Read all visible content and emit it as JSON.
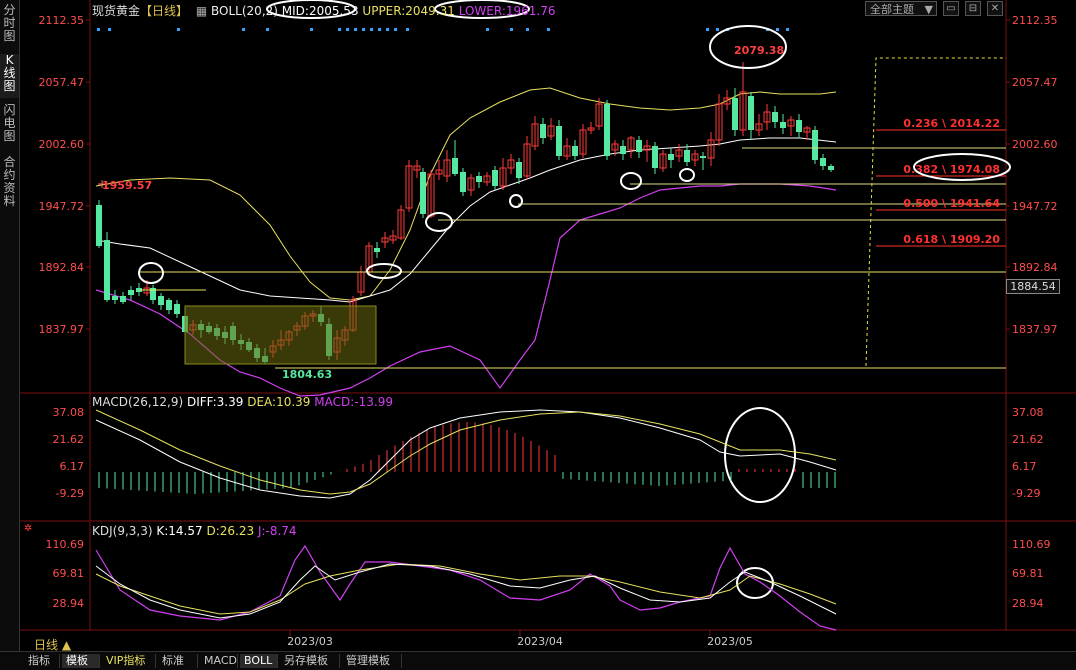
{
  "sidebar": {
    "tabs": [
      {
        "label": "分时图",
        "active": false
      },
      {
        "label": "K线图",
        "active": true
      },
      {
        "label": "闪电图",
        "active": false
      },
      {
        "label": "合约资料",
        "active": false
      }
    ]
  },
  "header": {
    "title": "现货黄金",
    "period": "【日线】",
    "boll_label": "BOLL(20,2)",
    "mid": "MID:2005.53",
    "upper": "UPPER:2049.31",
    "lower": "LOWER:1961.76"
  },
  "toolbar": {
    "theme_select": "全部主题",
    "buttons": [
      "▭",
      "⊟",
      "✕"
    ]
  },
  "price_axis": {
    "labels": [
      "2112.35",
      "2057.47",
      "2002.60",
      "1947.72",
      "1892.84",
      "1837.97"
    ],
    "current_price": "1884.54"
  },
  "annotations": {
    "high_label": "2079.38",
    "low_label": "1804.63",
    "left_label": "1959.57",
    "fib": [
      {
        "label": "0.236 \\ 2014.22"
      },
      {
        "label": "0.382 \\ 1974.08"
      },
      {
        "label": "0.500 \\ 1941.64"
      },
      {
        "label": "0.618 \\ 1909.20"
      }
    ]
  },
  "macd": {
    "label": "MACD(26,12,9)",
    "diff": "DIFF:3.39",
    "dea": "DEA:10.39",
    "macd": "MACD:-13.99",
    "axis": [
      "37.08",
      "21.62",
      "6.17",
      "-9.29"
    ]
  },
  "kdj": {
    "label": "KDJ(9,3,3)",
    "k": "K:14.57",
    "d": "D:26.23",
    "j": "J:-8.74",
    "axis": [
      "110.69",
      "69.81",
      "28.94"
    ]
  },
  "time_axis": [
    "2023/03",
    "2023/04",
    "2023/05"
  ],
  "period_label": "日线 ▲",
  "bottom_tabs": [
    {
      "label": "指标",
      "active": false
    },
    {
      "label": "模板",
      "active": true
    },
    {
      "label": "VIP指标",
      "active": false
    },
    {
      "label": "标准",
      "active": false
    },
    {
      "label": "MACD",
      "active": false
    },
    {
      "label": "BOLL",
      "active": true
    },
    {
      "label": "另存模板",
      "active": false
    },
    {
      "label": "管理模板",
      "active": false
    }
  ],
  "colors": {
    "up": "#ff3b3b",
    "down": "#54e8a0",
    "price_text": "#ff4d4d",
    "mid": "#ffffff",
    "upper": "#e8e060",
    "lower": "#d040f0",
    "dea": "#e8e060",
    "diff": "#ffffff",
    "kdj_j": "#d040f0",
    "kdj_d": "#e8e060",
    "kdj_k": "#ffffff",
    "fib_line": "#ff3030",
    "support_line": "#e8e060"
  }
}
